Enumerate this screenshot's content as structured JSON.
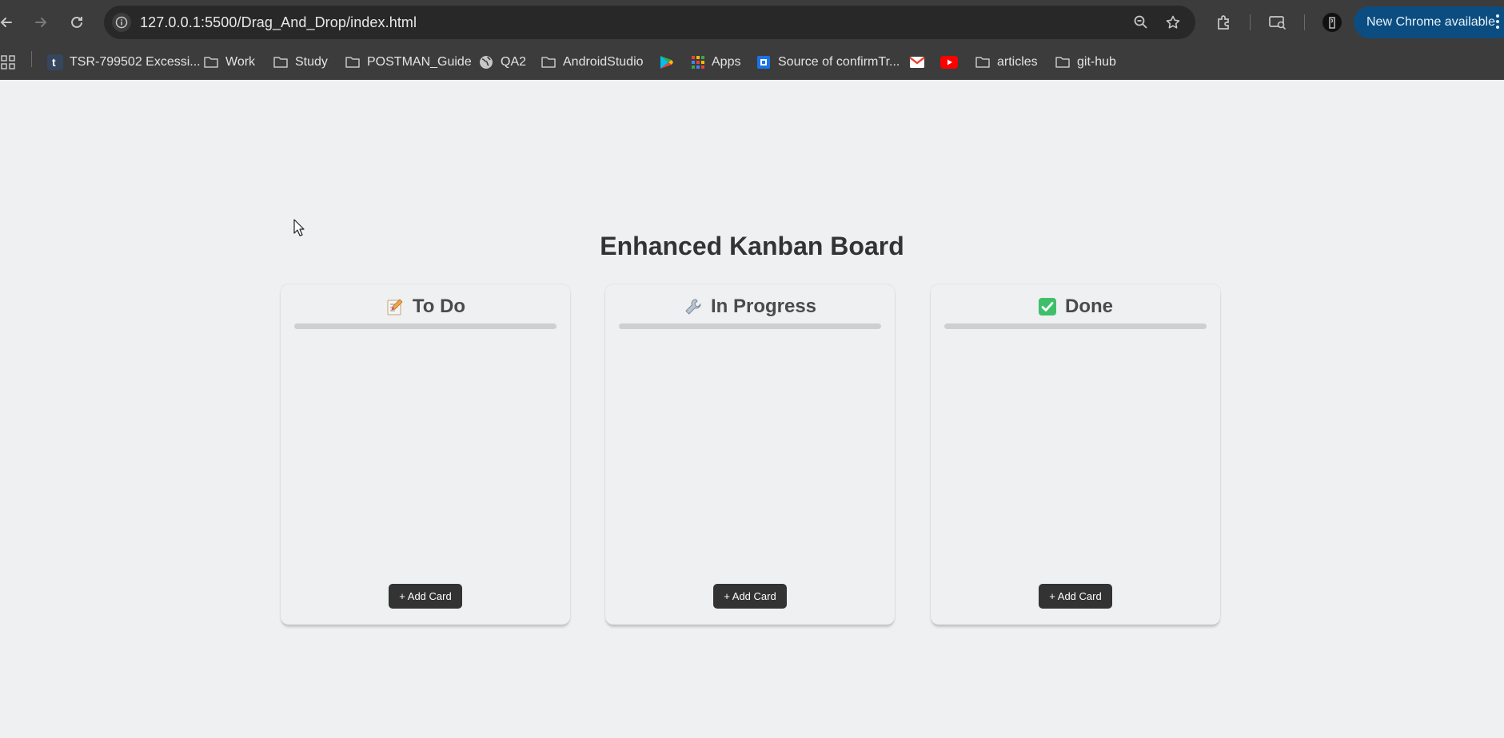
{
  "browser": {
    "url": "127.0.0.1:5500/Drag_And_Drop/index.html",
    "update_button": "New Chrome available",
    "bookmarks": [
      {
        "label": "TSR-799502 Excessi...",
        "icon": "tumblr-icon"
      },
      {
        "label": "Work",
        "icon": "folder-icon"
      },
      {
        "label": "Study",
        "icon": "folder-icon"
      },
      {
        "label": "POSTMAN_Guide",
        "icon": "folder-icon"
      },
      {
        "label": "QA2",
        "icon": "globe-icon"
      },
      {
        "label": "AndroidStudio",
        "icon": "folder-icon"
      },
      {
        "label": "Apps",
        "icon": "apps-grid-icon"
      },
      {
        "label": "Source of confirmTr...",
        "icon": "bookmark-site-icon"
      },
      {
        "label": "articles",
        "icon": "folder-icon"
      },
      {
        "label": "git-hub",
        "icon": "folder-icon"
      }
    ]
  },
  "page": {
    "title": "Enhanced Kanban Board",
    "columns": [
      {
        "title": "To Do",
        "icon": "memo-icon",
        "add_label": "+ Add Card"
      },
      {
        "title": "In Progress",
        "icon": "wrench-icon",
        "add_label": "+ Add Card"
      },
      {
        "title": "Done",
        "icon": "check-mark-icon",
        "add_label": "+ Add Card"
      }
    ]
  },
  "colors": {
    "chrome_bg": "#3c3c3c",
    "page_bg": "#eef0f2",
    "button_bg": "#333333",
    "update_button_bg": "#0b4d80"
  }
}
